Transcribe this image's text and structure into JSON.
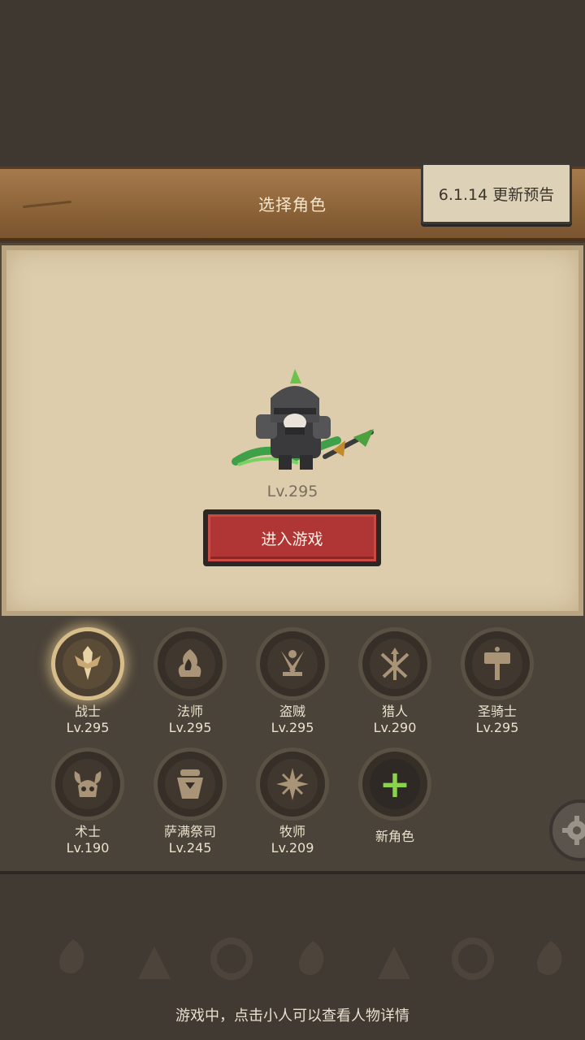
{
  "header": {
    "title": "选择角色",
    "update_notice": "6.1.14 更新预告"
  },
  "hero": {
    "level": "Lv.295",
    "enter_button": "进入游戏"
  },
  "classes": [
    {
      "name": "战士",
      "level": "Lv.295",
      "icon": "warrior-sword-icon",
      "selected": true
    },
    {
      "name": "法师",
      "level": "Lv.295",
      "icon": "mage-flame-icon",
      "selected": false
    },
    {
      "name": "盗贼",
      "level": "Lv.295",
      "icon": "rogue-daggers-icon",
      "selected": false
    },
    {
      "name": "猎人",
      "level": "Lv.290",
      "icon": "hunter-arrows-icon",
      "selected": false
    },
    {
      "name": "圣骑士",
      "level": "Lv.295",
      "icon": "paladin-hammer-icon",
      "selected": false
    },
    {
      "name": "术士",
      "level": "Lv.190",
      "icon": "warlock-skull-icon",
      "selected": false
    },
    {
      "name": "萨满祭司",
      "level": "Lv.245",
      "icon": "shaman-totem-icon",
      "selected": false
    },
    {
      "name": "牧师",
      "level": "Lv.209",
      "icon": "priest-star-icon",
      "selected": false
    }
  ],
  "new_character": {
    "label": "新角色",
    "icon": "plus-icon"
  },
  "footer": {
    "hint": "游戏中，点击小人可以查看人物详情"
  },
  "colors": {
    "enter_button": "#b03535",
    "plus": "#8bd24d",
    "selected_ring": "#d7bd8a"
  }
}
